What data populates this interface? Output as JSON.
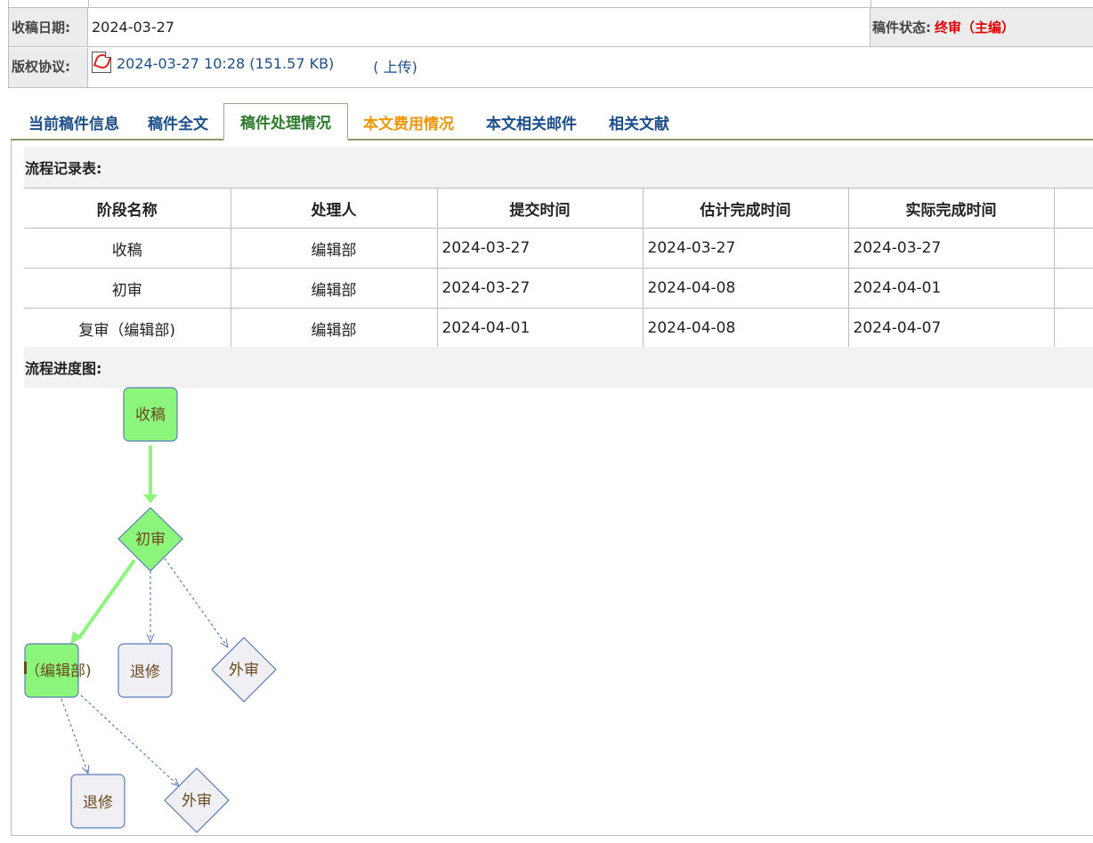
{
  "info": {
    "receive_date_label": "收稿日期:",
    "receive_date": "2024-03-27",
    "status_label": "稿件状态:",
    "status_value": "终审（主编）",
    "copyright_label": "版权协议:",
    "copyright_file": "2024-03-27 10:28 (151.57 KB)",
    "upload_link": "( 上传)"
  },
  "tabs": [
    {
      "label": "当前稿件信息"
    },
    {
      "label": "稿件全文"
    },
    {
      "label": "稿件处理情况"
    },
    {
      "label": "本文费用情况"
    },
    {
      "label": "本文相关邮件"
    },
    {
      "label": "相关文献"
    }
  ],
  "flow_table": {
    "title": "流程记录表:",
    "headers": [
      "阶段名称",
      "处理人",
      "提交时间",
      "估计完成时间",
      "实际完成时间"
    ],
    "rows": [
      [
        "收稿",
        "编辑部",
        "2024-03-27",
        "2024-03-27",
        "2024-03-27"
      ],
      [
        "初审",
        "编辑部",
        "2024-03-27",
        "2024-04-08",
        "2024-04-01"
      ],
      [
        "复审（编辑部)",
        "编辑部",
        "2024-04-01",
        "2024-04-08",
        "2024-04-07"
      ]
    ]
  },
  "flow_chart": {
    "title": "流程进度图:",
    "nodes": {
      "receive": "收稿",
      "first_review": "初审",
      "second_review": "（编辑部)",
      "revise_1": "退修",
      "external_1": "外审",
      "revise_2": "退修",
      "external_2": "外审"
    }
  },
  "colors": {
    "done_fill": "#8cf57c",
    "pending_fill": "#efeff4",
    "node_stroke": "#5b7cb8",
    "arrow_done": "#8cf57c",
    "arrow_pending": "#5b7cb8",
    "status_red": "#e00000",
    "tab_orange": "#f0960a",
    "tab_active": "#2d7a2d",
    "link_blue": "#1c4e8a"
  }
}
